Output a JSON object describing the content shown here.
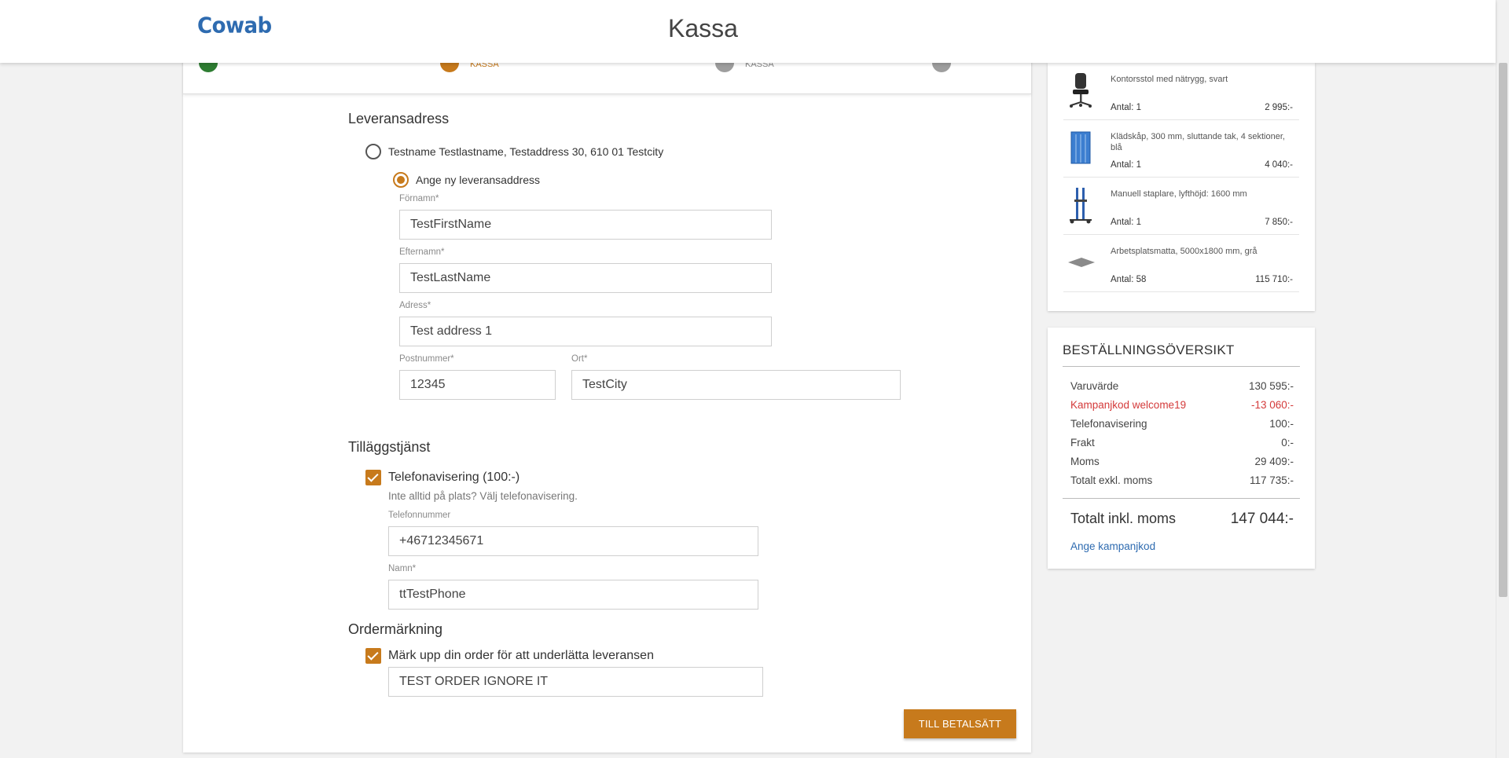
{
  "header": {
    "logo": "Cowab",
    "title": "Kassa"
  },
  "steps": [
    {
      "label": "",
      "color": "#2e7d32"
    },
    {
      "label": "KASSA",
      "color": "#c77a1c"
    },
    {
      "label": "KASSA",
      "color": "#9e9e9e"
    },
    {
      "label": "",
      "color": "#9e9e9e"
    }
  ],
  "delivery": {
    "title": "Leveransadress",
    "existing_address": "Testname Testlastname, Testaddress 30, 610 01 Testcity",
    "new_address_label": "Ange ny leveransaddress",
    "fields": {
      "firstname": {
        "label": "Förnamn*",
        "value": "TestFirstName"
      },
      "lastname": {
        "label": "Efternamn*",
        "value": "TestLastName"
      },
      "address": {
        "label": "Adress*",
        "value": "Test address 1"
      },
      "zip": {
        "label": "Postnummer*",
        "value": "12345"
      },
      "city": {
        "label": "Ort*",
        "value": "TestCity"
      }
    }
  },
  "addon": {
    "title": "Tilläggstjänst",
    "phone_notice_label": "Telefonavisering (100:-)",
    "phone_notice_hint": "Inte alltid på plats? Välj telefonavisering.",
    "phone": {
      "label": "Telefonnummer",
      "value": "+46712345671"
    },
    "name": {
      "label": "Namn*",
      "value": "ttTestPhone"
    }
  },
  "order_marking": {
    "title": "Ordermärkning",
    "checkbox_label": "Märk upp din order för att underlätta leveransen",
    "value": "TEST ORDER IGNORE IT"
  },
  "submit_label": "TILL BETALSÄTT",
  "cart": {
    "items": [
      {
        "name": "Kontorsstol med nätrygg, svart",
        "qty": "Antal: 1",
        "price": "2 995:-",
        "icon": "office-chair"
      },
      {
        "name": "Klädskåp, 300 mm, sluttande tak, 4 sektioner, blå",
        "qty": "Antal: 1",
        "price": "4 040:-",
        "icon": "locker"
      },
      {
        "name": "Manuell staplare, lyfthöjd: 1600 mm",
        "qty": "Antal: 1",
        "price": "7 850:-",
        "icon": "stacker"
      },
      {
        "name": "Arbetsplatsmatta, 5000x1800 mm, grå",
        "qty": "Antal: 58",
        "price": "115 710:-",
        "icon": "mat"
      }
    ]
  },
  "summary": {
    "title": "BESTÄLLNINGSÖVERSIKT",
    "rows": [
      {
        "label": "Varuvärde",
        "value": "130 595:-"
      },
      {
        "label": "Kampanjkod welcome19",
        "value": "-13 060:-"
      },
      {
        "label": "Telefonavisering",
        "value": "100:-"
      },
      {
        "label": "Frakt",
        "value": "0:-"
      },
      {
        "label": "Moms",
        "value": "29 409:-"
      },
      {
        "label": "Totalt exkl. moms",
        "value": "117 735:-"
      }
    ],
    "total_label": "Totalt inkl. moms",
    "total_value": "147 044:-",
    "campaign_link": "Ange kampanjkod"
  },
  "colors": {
    "accent": "#c77a1c",
    "brand": "#2e6bb0",
    "discount": "#d43a3a"
  }
}
